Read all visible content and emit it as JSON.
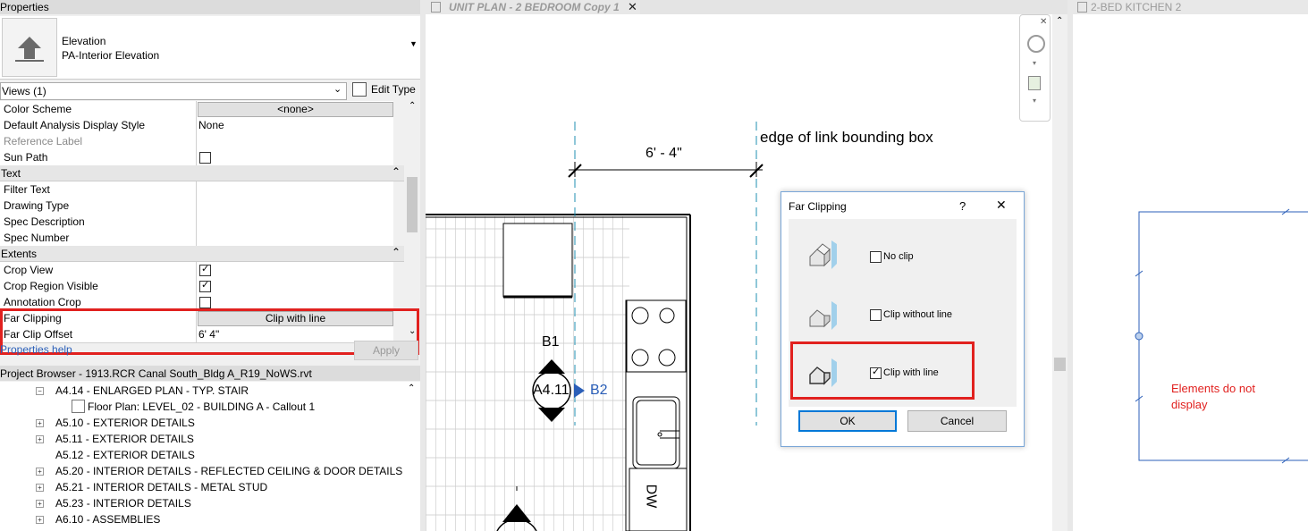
{
  "properties": {
    "title": "Properties",
    "type_name": "Elevation",
    "type_subname": "PA-Interior Elevation",
    "views_selector": "Views (1)",
    "edit_type": "Edit Type",
    "rows_a": [
      {
        "label": "Color Scheme",
        "value": "<none>"
      },
      {
        "label": "Default Analysis Display Style",
        "value": "None"
      },
      {
        "label": "Reference Label",
        "value": ""
      },
      {
        "label": "Sun Path",
        "value": ""
      }
    ],
    "group_text": "Text",
    "rows_text": [
      {
        "label": "Filter Text"
      },
      {
        "label": "Drawing Type"
      },
      {
        "label": "Spec Description"
      },
      {
        "label": "Spec Number"
      }
    ],
    "group_extents": "Extents",
    "rows_extents": [
      {
        "label": "Crop View"
      },
      {
        "label": "Crop Region Visible"
      },
      {
        "label": "Annotation Crop"
      },
      {
        "label": "Far Clipping",
        "value": "Clip with line"
      },
      {
        "label": "Far Clip Offset",
        "value": "6'  4\""
      }
    ],
    "help_link": "Properties help",
    "apply": "Apply"
  },
  "browser": {
    "title": "Project Browser - 1913.RCR Canal South_Bldg A_R19_NoWS.rvt",
    "items": [
      {
        "label": "A4.14 - ENLARGED PLAN - TYP. STAIR"
      },
      {
        "label": "Floor Plan: LEVEL_02 - BUILDING A - Callout 1"
      },
      {
        "label": "A5.10 - EXTERIOR DETAILS"
      },
      {
        "label": "A5.11 - EXTERIOR DETAILS"
      },
      {
        "label": "A5.12 - EXTERIOR DETAILS"
      },
      {
        "label": "A5.20 - INTERIOR DETAILS - REFLECTED CEILING & DOOR DETAILS"
      },
      {
        "label": "A5.21 - INTERIOR DETAILS - METAL STUD"
      },
      {
        "label": "A5.23 - INTERIOR DETAILS"
      },
      {
        "label": "A6.10 - ASSEMBLIES"
      }
    ]
  },
  "tabs": {
    "unit_plan": "UNIT PLAN  - 2 BEDROOM Copy 1",
    "kitchen": "2-BED KITCHEN 2"
  },
  "drawing": {
    "dimension": "6' - 4\"",
    "annotation": "edge of link bounding box",
    "tag_top": "B1",
    "tag_center": "A4.11",
    "tag_right": "B2",
    "dw": "DW",
    "note": "Elements do not display"
  },
  "dialog": {
    "title": "Far Clipping",
    "help": "?",
    "close": "✕",
    "options": [
      {
        "label": "No clip",
        "checked": false
      },
      {
        "label": "Clip without line",
        "checked": false
      },
      {
        "label": "Clip with line",
        "checked": true
      }
    ],
    "ok": "OK",
    "cancel": "Cancel"
  },
  "colors": {
    "highlight_red": "#e1211f",
    "link_blue": "#2b5fb8",
    "note_red": "#e1211f"
  }
}
